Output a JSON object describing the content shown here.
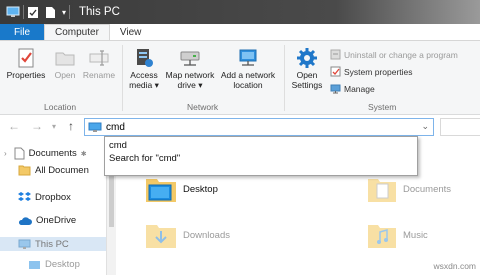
{
  "window": {
    "title": "This PC"
  },
  "tabs": [
    {
      "label": "File"
    },
    {
      "label": "Computer"
    },
    {
      "label": "View"
    }
  ],
  "ribbon": {
    "location_group": {
      "label": "Location",
      "properties": "Properties",
      "open": "Open",
      "rename": "Rename"
    },
    "network_group": {
      "label": "Network",
      "access_media": [
        "Access",
        "media ▾"
      ],
      "map_network_drive": [
        "Map network",
        "drive ▾"
      ],
      "add_network_location": [
        "Add a network",
        "location"
      ]
    },
    "system_group": {
      "label": "System",
      "open_settings": [
        "Open",
        "Settings"
      ],
      "uninstall": "Uninstall or change a program",
      "system_properties": "System properties",
      "manage": "Manage"
    }
  },
  "address": {
    "value": "cmd"
  },
  "suggestions": [
    "cmd",
    "Search for \"cmd\""
  ],
  "sidebar": {
    "items": [
      {
        "label": "Documents"
      },
      {
        "label": "All Documen"
      },
      {
        "label": "Dropbox"
      },
      {
        "label": "OneDrive"
      },
      {
        "label": "This PC"
      },
      {
        "label": "Desktop"
      }
    ]
  },
  "folders": [
    {
      "label": "Desktop"
    },
    {
      "label": "Documents"
    },
    {
      "label": "Downloads"
    },
    {
      "label": "Music"
    }
  ],
  "watermark": "wsxdn.com",
  "colors": {
    "accent": "#1979ca",
    "titlebar": "#3a3a3a",
    "folder": "#f3c967",
    "selection": "#d9e7f5"
  }
}
